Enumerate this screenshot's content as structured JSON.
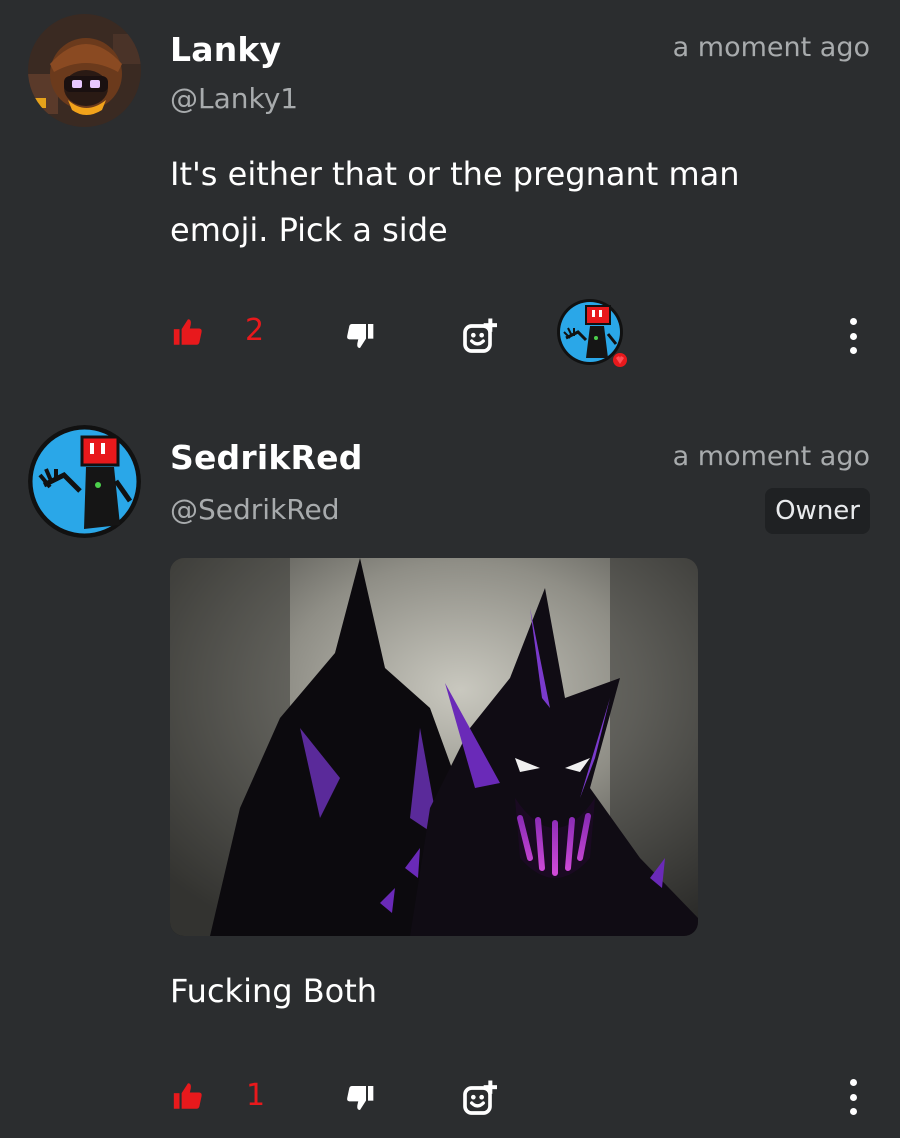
{
  "comments": [
    {
      "author": "Lanky",
      "handle": "@Lanky1",
      "time": "a moment ago",
      "text": "It's either that or the pregnant man emoji. Pick a side",
      "likes": "2",
      "has_reactor_avatar": true,
      "icons": {
        "avatar": "user-avatar-lanky",
        "like": "thumbs-up-icon",
        "dislike": "thumbs-down-icon",
        "react": "add-reaction-icon",
        "more": "more-vertical-icon"
      }
    },
    {
      "author": "SedrikRed",
      "handle": "@SedrikRed",
      "time": "a moment ago",
      "badge": "Owner",
      "text": "Fucking Both",
      "likes": "1",
      "icons": {
        "avatar": "user-avatar-sedrikred",
        "like": "thumbs-up-icon",
        "dislike": "thumbs-down-icon",
        "react": "add-reaction-icon",
        "more": "more-vertical-icon"
      }
    }
  ],
  "colors": {
    "background": "#2b2d2f",
    "like_active": "#e8191c",
    "muted_text": "#a8abad",
    "avatar_blue": "#2aa7e8"
  }
}
